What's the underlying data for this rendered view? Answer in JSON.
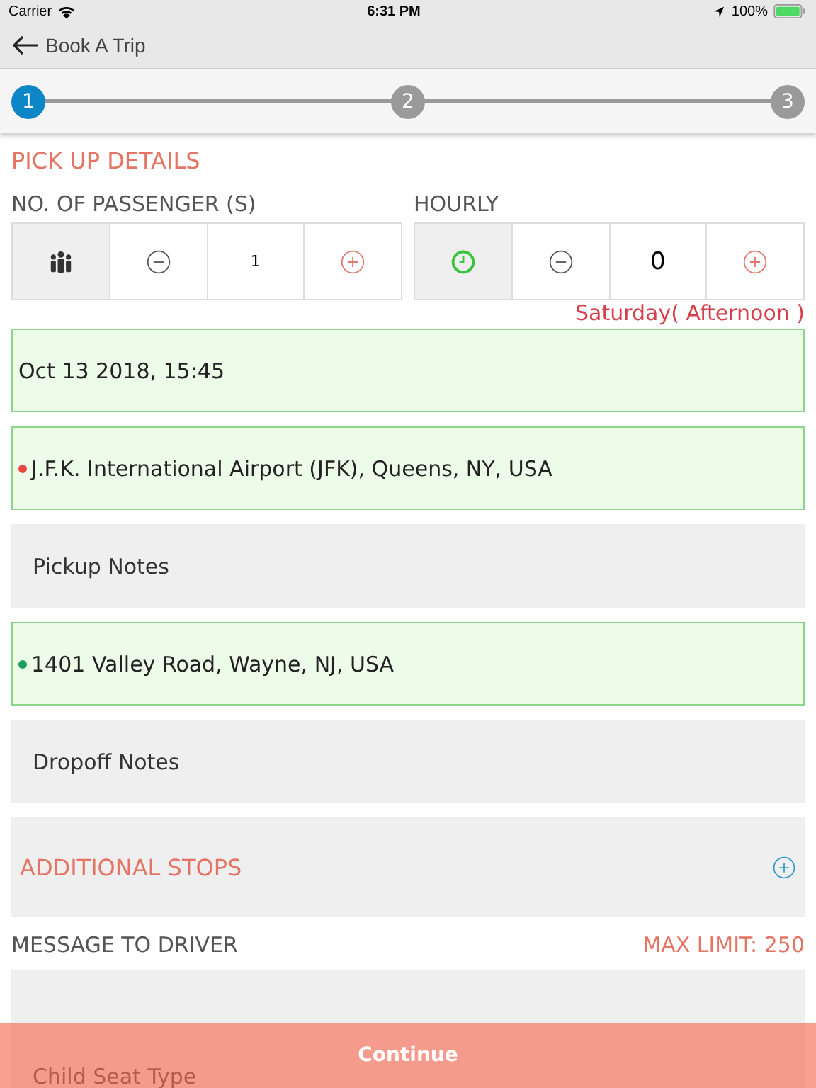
{
  "status_bar": {
    "carrier": "Carrier",
    "time": "6:31 PM",
    "battery": "100%"
  },
  "nav": {
    "title": "Book A Trip"
  },
  "steps": [
    {
      "label": "1",
      "selected": true
    },
    {
      "label": "2",
      "selected": false
    },
    {
      "label": "3",
      "selected": false
    }
  ],
  "section_title": "PICK UP DETAILS",
  "counters": [
    {
      "label": "NO. OF PASSENGER (S)",
      "kind": "people",
      "value": "1"
    },
    {
      "label": "HOURLY",
      "kind": "clock",
      "value": "0"
    }
  ],
  "day_note": "Saturday( Afternoon )",
  "fields": [
    {
      "kind": "date",
      "value": "Oct 13 2018, 15:45"
    },
    {
      "kind": "location",
      "value": "J.F.K. International Airport (JFK), Queens, NY, USA",
      "color": "#e8473f"
    },
    {
      "kind": "notes",
      "placeholder": "Pickup Notes"
    },
    {
      "kind": "location",
      "value": "1401 Valley Road, Wayne, NJ, USA",
      "color": "#1aa05a"
    },
    {
      "kind": "notes",
      "placeholder": "Dropoff Notes"
    }
  ],
  "additional_stops": "ADDITIONAL STOPS",
  "message": {
    "label": "MESSAGE TO DRIVER",
    "limit": "MAX LIMIT: 250"
  },
  "child_seat": {
    "placeholder": "Child Seat Type"
  },
  "continue_button": "Continue"
}
